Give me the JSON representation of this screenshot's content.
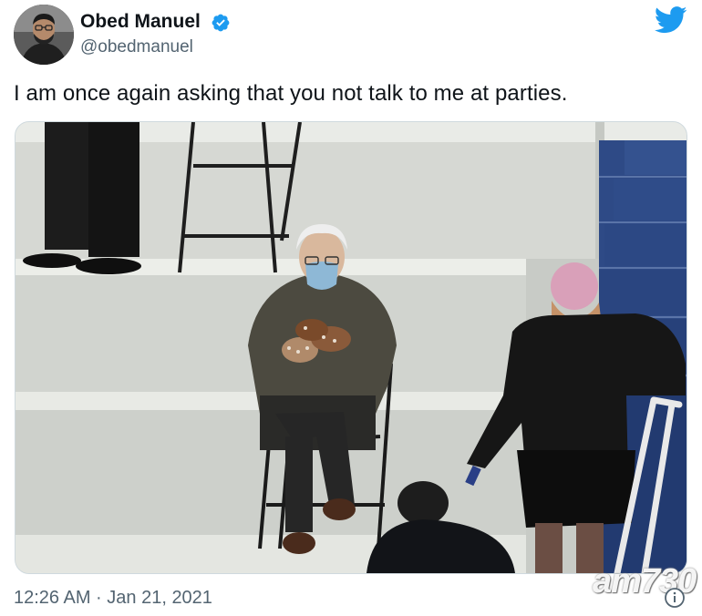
{
  "tweet": {
    "author_name": "Obed Manuel",
    "author_handle": "@obedmanuel",
    "text": "I am once again asking that you not talk to me at parties.",
    "timestamp": "12:26 AM · Jan 21, 2021"
  },
  "watermark": {
    "text": "am730"
  },
  "icons": {
    "verified": "verified-badge-icon",
    "logo": "twitter-bird-icon",
    "info": "info-icon"
  },
  "colors": {
    "brand": "#1d9bf0",
    "text": "#0f1419",
    "secondary": "#536471",
    "border": "#cfd9de"
  }
}
